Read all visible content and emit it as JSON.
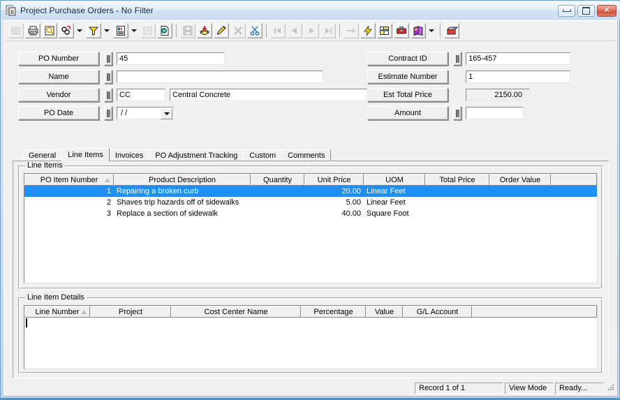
{
  "window": {
    "title": "Project Purchase Orders - No Filter",
    "icon": "document-grid-icon",
    "buttons": {
      "minimize": "minimize-button",
      "maximize": "maximize-button",
      "close": "close-button"
    }
  },
  "toolbar": {
    "items": [
      {
        "name": "select-all-icon",
        "kind": "button",
        "disabled": true
      },
      {
        "name": "print-icon",
        "kind": "button",
        "disabled": false
      },
      {
        "name": "print-preview-icon",
        "kind": "button",
        "disabled": false
      },
      {
        "name": "find-icon",
        "kind": "button",
        "disabled": false
      },
      {
        "name": "find-dropdown",
        "kind": "dropdown"
      },
      {
        "name": "filter-icon",
        "kind": "button",
        "disabled": false
      },
      {
        "name": "filter-dropdown",
        "kind": "dropdown"
      },
      {
        "name": "report-icon",
        "kind": "button",
        "disabled": false
      },
      {
        "name": "report-dropdown",
        "kind": "dropdown"
      },
      {
        "name": "properties-icon",
        "kind": "button",
        "disabled": true
      },
      {
        "name": "export-icon",
        "kind": "button",
        "disabled": false
      },
      {
        "name": "separator-1",
        "kind": "separator"
      },
      {
        "name": "save-icon",
        "kind": "button",
        "disabled": true
      },
      {
        "name": "new-record-icon",
        "kind": "button",
        "disabled": false
      },
      {
        "name": "edit-record-icon",
        "kind": "button",
        "disabled": false
      },
      {
        "name": "delete-record-icon",
        "kind": "button",
        "disabled": true
      },
      {
        "name": "cut-icon",
        "kind": "button",
        "disabled": false
      },
      {
        "name": "separator-2",
        "kind": "separator"
      },
      {
        "name": "first-record-icon",
        "kind": "button",
        "disabled": true
      },
      {
        "name": "previous-record-icon",
        "kind": "button",
        "disabled": true
      },
      {
        "name": "next-record-icon",
        "kind": "button",
        "disabled": true
      },
      {
        "name": "last-record-icon",
        "kind": "button",
        "disabled": true
      },
      {
        "name": "separator-3",
        "kind": "separator"
      },
      {
        "name": "goto-record-icon",
        "kind": "button",
        "disabled": true
      },
      {
        "name": "quick-action-icon",
        "kind": "button",
        "disabled": false
      },
      {
        "name": "layout-icon",
        "kind": "button",
        "disabled": false
      },
      {
        "name": "toolbox-icon",
        "kind": "button",
        "disabled": false
      },
      {
        "name": "help-book-icon",
        "kind": "button",
        "disabled": false
      },
      {
        "name": "help-dropdown",
        "kind": "dropdown"
      },
      {
        "name": "separator-4",
        "kind": "separator"
      },
      {
        "name": "exit-icon",
        "kind": "button",
        "disabled": false
      }
    ]
  },
  "form": {
    "left": [
      {
        "label": "PO Number",
        "value": "45",
        "has_lookup": true,
        "type": "text"
      },
      {
        "label": "Name",
        "value": "",
        "has_lookup": true,
        "type": "text"
      },
      {
        "label": "Vendor",
        "value": "CC",
        "value2": "Central Concrete",
        "has_lookup": true,
        "type": "text2"
      },
      {
        "label": "PO Date",
        "value": "/  /",
        "has_lookup": true,
        "type": "combo"
      }
    ],
    "right": [
      {
        "label": "Contract ID",
        "value": "165-457",
        "has_lookup": true,
        "type": "text"
      },
      {
        "label": "Estimate Number",
        "value": "1",
        "has_lookup": false,
        "type": "text"
      },
      {
        "label": "Est Total Price",
        "value": "2150.00",
        "has_lookup": false,
        "type": "static"
      },
      {
        "label": "Amount",
        "value": "",
        "has_lookup": true,
        "type": "text"
      }
    ]
  },
  "tabs": {
    "active": "Line Items",
    "items": [
      "General",
      "Line Items",
      "Invoices",
      "PO Adjustment Tracking",
      "Custom",
      "Comments"
    ]
  },
  "line_items": {
    "group_label": "Line Items",
    "columns": [
      "PO Item Number",
      "Product Description",
      "Quantity",
      "Unit Price",
      "UOM",
      "Total Price",
      "Order Value",
      ""
    ],
    "sorted_column": "PO Item Number",
    "selected_row_index": 0,
    "rows": [
      {
        "po_item_number": "1",
        "product_description": "Repairing a broken curb",
        "quantity": "",
        "unit_price": "20.00",
        "uom": "Linear Feet",
        "total_price": "",
        "order_value": ""
      },
      {
        "po_item_number": "2",
        "product_description": "Shaves trip hazards off of sidewalks",
        "quantity": "",
        "unit_price": "5.00",
        "uom": "Linear Feet",
        "total_price": "",
        "order_value": ""
      },
      {
        "po_item_number": "3",
        "product_description": "Replace a section of sidewalk",
        "quantity": "",
        "unit_price": "40.00",
        "uom": "Square Foot",
        "total_price": "",
        "order_value": ""
      }
    ]
  },
  "line_item_details": {
    "group_label": "Line Item Details",
    "columns": [
      "Line Number",
      "Project",
      "Cost Center Name",
      "Percentage",
      "Value",
      "G/L Account",
      ""
    ],
    "sorted_column": "Line Number",
    "rows": []
  },
  "statusbar": {
    "record": "Record 1 of 1",
    "mode": "View Mode",
    "state": "Ready...",
    "grip": "resize-grip"
  },
  "colors": {
    "selection": "#1e90f5",
    "face": "#f0f0f0",
    "window_frame": "#6fa3c9",
    "close_button": "#cf4f39"
  }
}
